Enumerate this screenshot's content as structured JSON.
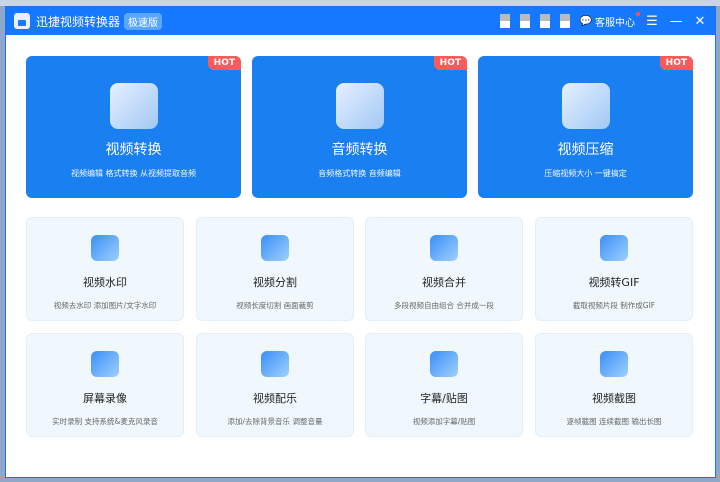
{
  "titlebar": {
    "title": "迅捷视频转换器",
    "edition": "极速版",
    "service": "客服中心",
    "menu_icon": "menu-icon",
    "min_icon": "minimize-icon",
    "close_icon": "close-icon"
  },
  "featured": [
    {
      "title": "视频转换",
      "desc": "视频编辑 格式转换 从视频提取音频",
      "badge": "HOT"
    },
    {
      "title": "音频转换",
      "desc": "音频格式转换 音频编辑",
      "badge": "HOT"
    },
    {
      "title": "视频压缩",
      "desc": "压缩视频大小 一键搞定",
      "badge": "HOT"
    }
  ],
  "tools": [
    {
      "title": "视频水印",
      "desc": "视频去水印 添加图片/文字水印"
    },
    {
      "title": "视频分割",
      "desc": "视频长度切割 画面裁剪"
    },
    {
      "title": "视频合并",
      "desc": "多段视频自由组合 合并成一段"
    },
    {
      "title": "视频转GIF",
      "desc": "截取视频片段 制作成GIF"
    },
    {
      "title": "屏幕录像",
      "desc": "实时录制 支持系统&麦克风录音"
    },
    {
      "title": "视频配乐",
      "desc": "添加/去除背景音乐 调整音量"
    },
    {
      "title": "字幕/贴图",
      "desc": "视频添加字幕/贴图"
    },
    {
      "title": "视频截图",
      "desc": "逐帧截图 连续截图 输出长图"
    }
  ],
  "colors": {
    "primary": "#1677ff",
    "card": "#1a7ff0",
    "hot": "#ff5a5a",
    "tile": "#f0f8fe"
  }
}
